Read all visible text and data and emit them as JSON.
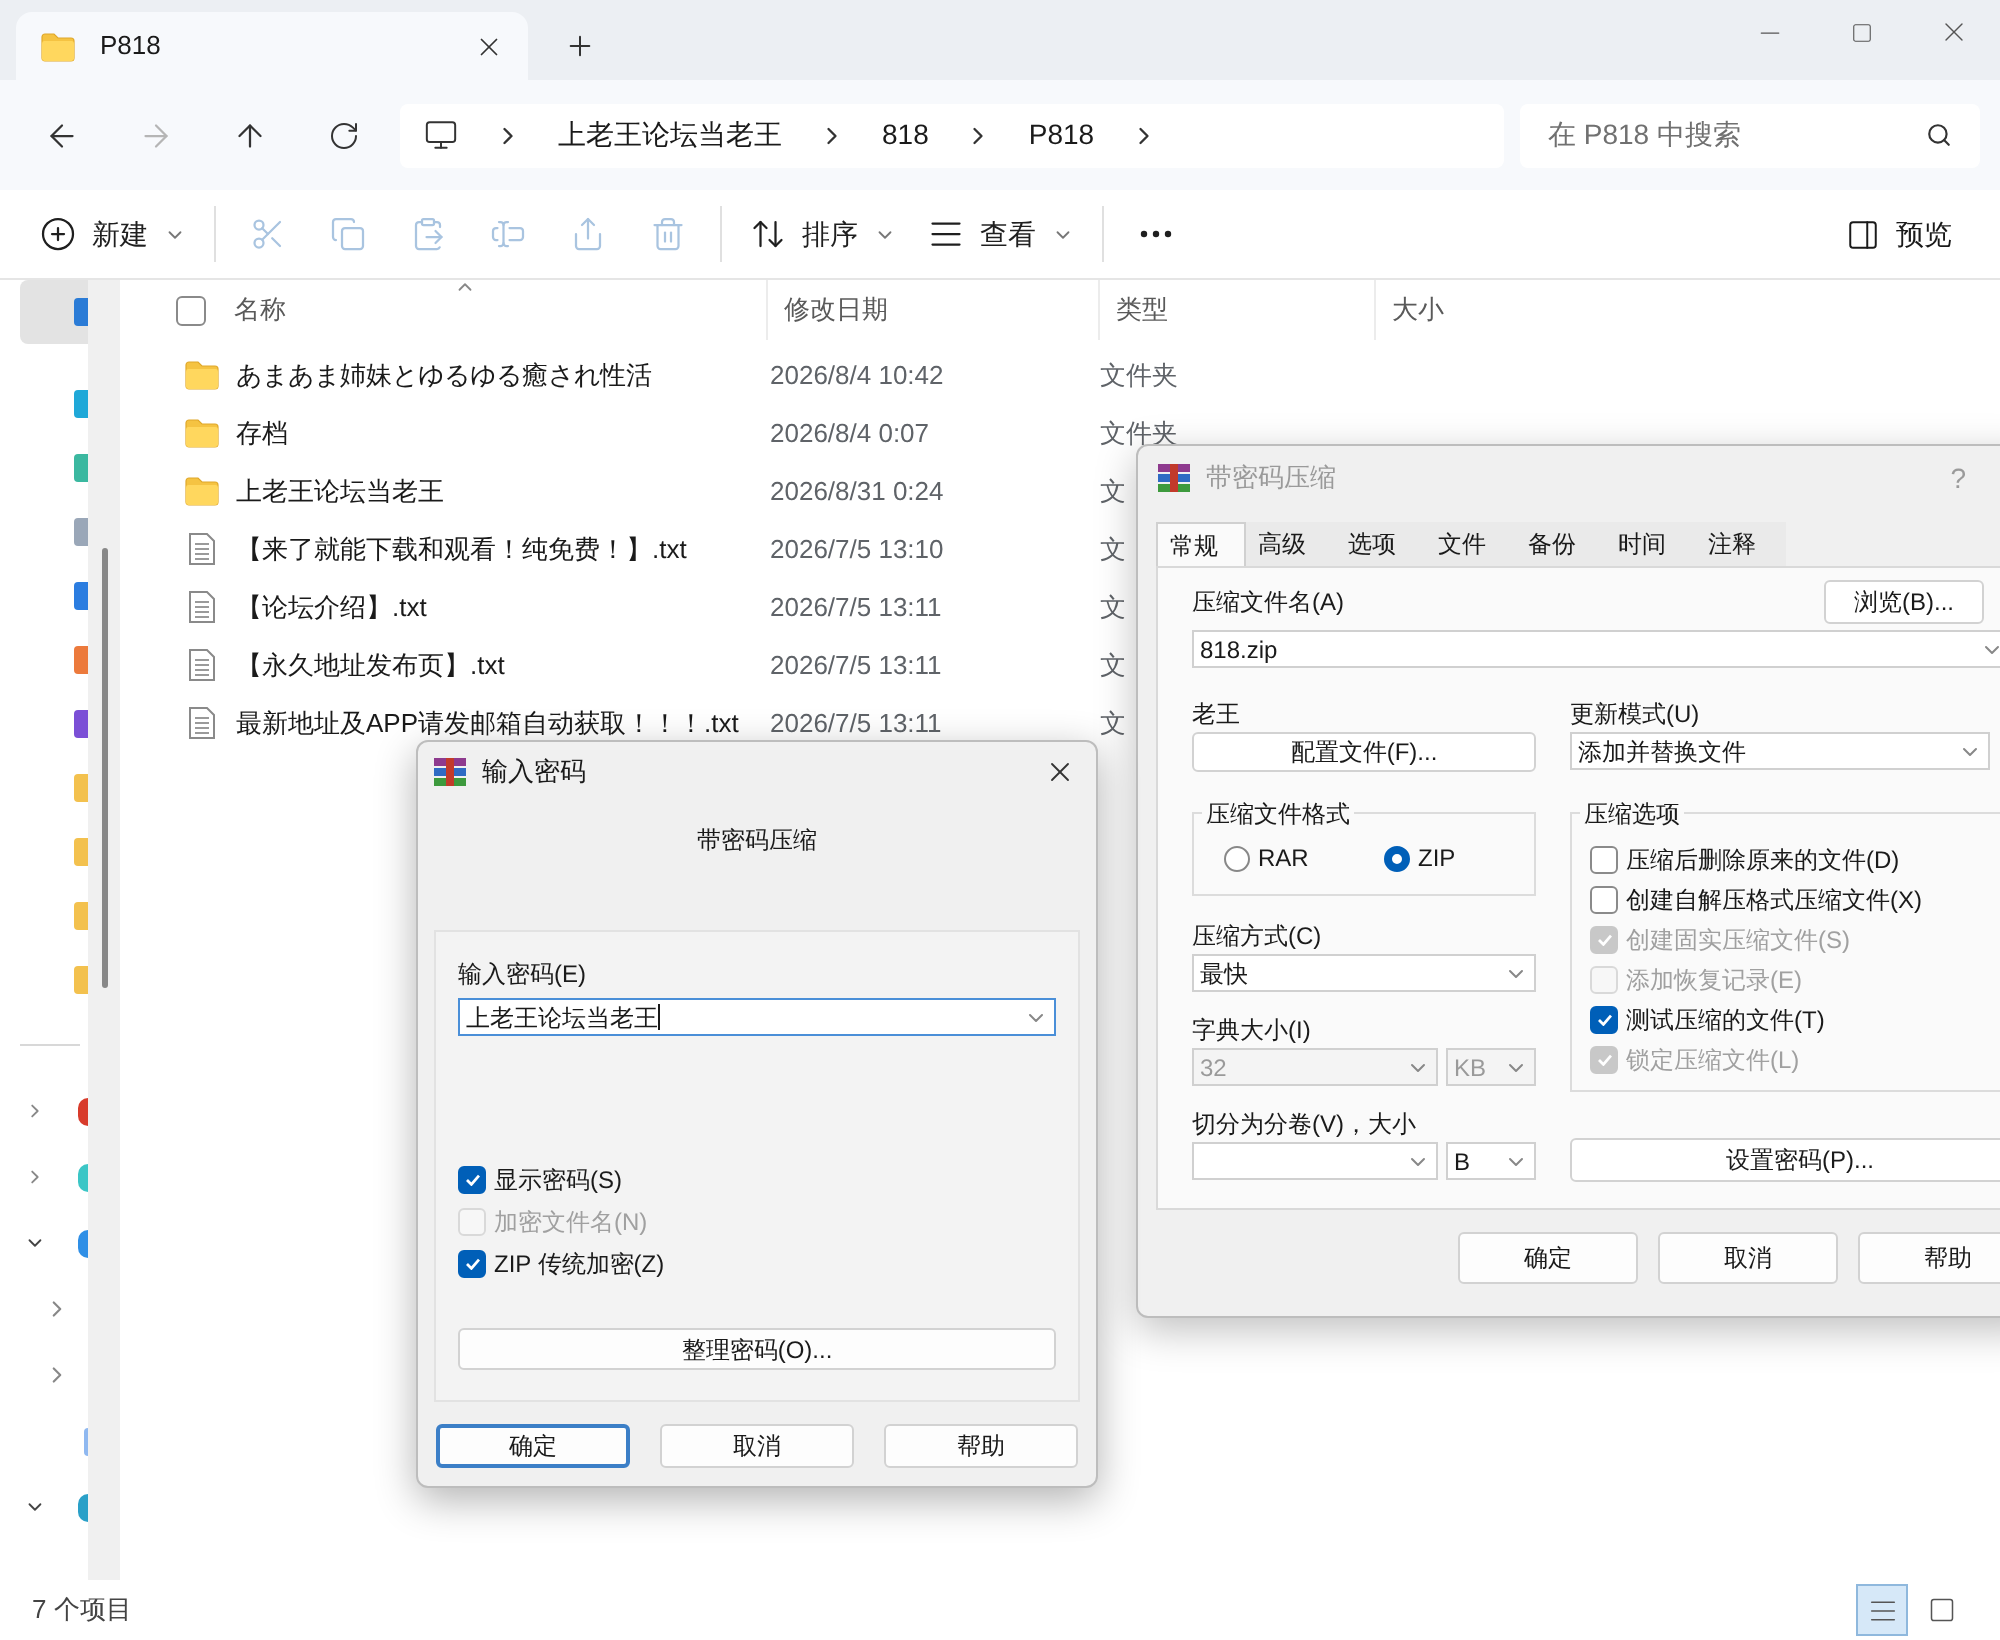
{
  "explorer": {
    "tab": {
      "title": "P818"
    },
    "breadcrumb": [
      "上老王论坛当老王",
      "818",
      "P818"
    ],
    "search": {
      "placeholder": "在 P818 中搜索"
    },
    "toolbar": [
      {
        "kind": "new",
        "label": "新建",
        "dropdown": true,
        "disabled": false
      },
      {
        "kind": "cut",
        "disabled": true
      },
      {
        "kind": "copy",
        "disabled": true
      },
      {
        "kind": "paste",
        "disabled": true
      },
      {
        "kind": "rename",
        "disabled": true
      },
      {
        "kind": "share",
        "disabled": true
      },
      {
        "kind": "delete",
        "disabled": true
      },
      {
        "kind": "sort",
        "label": "排序",
        "dropdown": true,
        "disabled": false
      },
      {
        "kind": "view",
        "label": "查看",
        "dropdown": true,
        "disabled": false
      },
      {
        "kind": "more",
        "disabled": false
      }
    ],
    "preview": {
      "label": "预览"
    },
    "sidebar": {
      "items": [
        {
          "color": "#2a7bd6",
          "selected": true
        },
        {
          "color": "#1fa8d8",
          "selected": false
        },
        {
          "color": "#3bb8a0",
          "selected": false
        },
        {
          "color": "#9aa7b8",
          "selected": false
        },
        {
          "color": "#2b7de0",
          "selected": false
        },
        {
          "color": "#ec7a3c",
          "selected": false
        },
        {
          "color": "#7b4fd6",
          "selected": false
        },
        {
          "color": "#f3c14e",
          "selected": false
        },
        {
          "color": "#f3c14e",
          "selected": false
        },
        {
          "color": "#f3c14e",
          "selected": false
        },
        {
          "color": "#f3c14e",
          "selected": false
        }
      ],
      "tree": [
        {
          "expanded": false,
          "color": "#d83b2b"
        },
        {
          "expanded": false,
          "color": "#3cc6c6"
        },
        {
          "expanded": true,
          "color": "#2f8fe6",
          "children": [
            {
              "expanded": false
            },
            {
              "expanded": false
            },
            {
              "color": "#8fb8f0"
            }
          ]
        },
        {
          "expanded": true,
          "color": "#2aa0c8"
        }
      ]
    },
    "select_all": {
      "checked": false
    },
    "columns": [
      "名称",
      "修改日期",
      "类型",
      "大小"
    ],
    "rows": [
      {
        "kind": "folder",
        "name": "あまあま姉妹とゆるゆる癒され性活",
        "date": "2026/8/4 10:42",
        "type": "文件夹"
      },
      {
        "kind": "folder",
        "name": "存档",
        "date": "2026/8/4 0:07",
        "type": "文件夹"
      },
      {
        "kind": "folder",
        "name": "上老王论坛当老王",
        "date": "2026/8/31 0:24",
        "type": "文"
      },
      {
        "kind": "file",
        "name": "【来了就能下载和观看！纯免费！】.txt",
        "date": "2026/7/5 13:10",
        "type": "文"
      },
      {
        "kind": "file",
        "name": "【论坛介绍】.txt",
        "date": "2026/7/5 13:11",
        "type": "文"
      },
      {
        "kind": "file",
        "name": "【永久地址发布页】.txt",
        "date": "2026/7/5 13:11",
        "type": "文"
      },
      {
        "kind": "file",
        "name": "最新地址及APP请发邮箱自动获取！！！.txt",
        "date": "2026/7/5 13:11",
        "type": "文"
      }
    ],
    "status": "7 个项目",
    "view_buttons": [
      {
        "kind": "details",
        "selected": true
      },
      {
        "kind": "tiles",
        "selected": false
      }
    ]
  },
  "archive_dialog": {
    "title": "带密码压缩",
    "help": "?",
    "tabs": [
      {
        "label": "常规",
        "selected": true
      },
      {
        "label": "高级",
        "selected": false
      },
      {
        "label": "选项",
        "selected": false
      },
      {
        "label": "文件",
        "selected": false
      },
      {
        "label": "备份",
        "selected": false
      },
      {
        "label": "时间",
        "selected": false
      },
      {
        "label": "注释",
        "selected": false
      }
    ],
    "archive_name_label": "压缩文件名(A)",
    "browse": "浏览(B)...",
    "archive_name": "818.zip",
    "profile_label": "老王",
    "profiles": "配置文件(F)...",
    "update_mode_label": "更新模式(U)",
    "update_mode": "添加并替换文件",
    "format_group": "压缩文件格式",
    "formats": [
      {
        "label": "RAR",
        "selected": false
      },
      {
        "label": "ZIP",
        "selected": true
      }
    ],
    "method_label": "压缩方式(C)",
    "method": "最快",
    "dict_label": "字典大小(I)",
    "dict_size": {
      "value": "32",
      "disabled": true
    },
    "dict_unit": {
      "value": "KB",
      "disabled": true
    },
    "volume_label": "切分为分卷(V)，大小",
    "volume_unit": {
      "value": "B",
      "disabled": false
    },
    "options_group": "压缩选项",
    "options": [
      {
        "label": "压缩后删除原来的文件(D)",
        "checked": false,
        "disabled": false
      },
      {
        "label": "创建自解压格式压缩文件(X)",
        "checked": false,
        "disabled": false
      },
      {
        "label": "创建固实压缩文件(S)",
        "checked": true,
        "disabled": true
      },
      {
        "label": "添加恢复记录(E)",
        "checked": false,
        "disabled": true
      },
      {
        "label": "测试压缩的文件(T)",
        "checked": true,
        "disabled": false
      },
      {
        "label": "锁定压缩文件(L)",
        "checked": true,
        "disabled": true
      }
    ],
    "set_password": "设置密码(P)...",
    "buttons": [
      {
        "label": "确定",
        "default": false
      },
      {
        "label": "取消",
        "default": false
      },
      {
        "label": "帮助",
        "default": false
      }
    ]
  },
  "password_dialog": {
    "title": "输入密码",
    "heading": "带密码压缩",
    "password_label": "输入密码(E)",
    "password": "上老王论坛当老王",
    "checkboxes": [
      {
        "label": "显示密码(S)",
        "checked": true,
        "disabled": false
      },
      {
        "label": "加密文件名(N)",
        "checked": false,
        "disabled": true
      },
      {
        "label": "ZIP 传统加密(Z)",
        "checked": true,
        "disabled": false
      }
    ],
    "organize": "整理密码(O)...",
    "buttons": [
      {
        "label": "确定",
        "default": true
      },
      {
        "label": "取消",
        "default": false
      },
      {
        "label": "帮助",
        "default": false
      }
    ]
  }
}
